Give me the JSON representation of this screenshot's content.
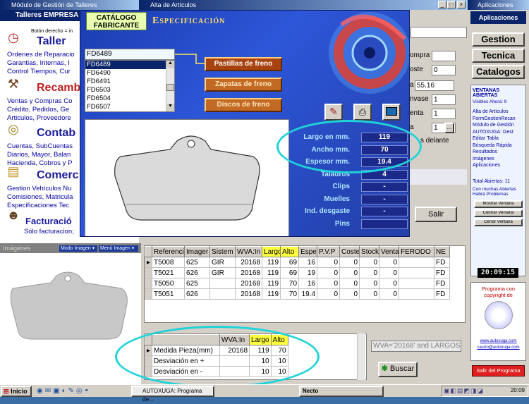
{
  "windows": {
    "left": {
      "title": "Módulo de Gestión de Talleres",
      "subtitle": "Talleres EMPRESA",
      "hint": "Botón derecho = in"
    },
    "alta": {
      "title": "Alta de Artículos"
    },
    "aplic": {
      "title": "Aplicaciones",
      "header": "Aplicaciones"
    }
  },
  "left_sections": [
    {
      "icon": "clock-icon",
      "title": "Taller",
      "lines": [
        "Ordenes de Reparacio",
        "Garantias, Internas, I",
        "Control Tiempos, Cur"
      ]
    },
    {
      "icon": "tools-icon",
      "title": "Recambio",
      "lines": [
        "Ventas y Compras Co",
        "Crédito, Pedidos, Ge",
        "Articulos, Proveedore"
      ]
    },
    {
      "icon": "coins-icon",
      "title": "Contab",
      "lines": [
        "Cuentas, SubCuentas",
        "Diarios, Mayor, Balan",
        "Hacienda, Cobros y P"
      ]
    },
    {
      "icon": "document-icon",
      "title": "Comerc",
      "lines": [
        "Gestion Vehículos Nu",
        "Comisiones, Matricula",
        "Especificaciones Tec"
      ]
    },
    {
      "icon": "person-icon",
      "title": "Facturació",
      "lines": [
        "Sólo facturacion;"
      ]
    }
  ],
  "catalog": {
    "logo_line1": "CATÁLOGO",
    "logo_line2": "FABRICANTE",
    "title": "Especificación",
    "search_value": "FD6489",
    "list_items": [
      "FD6489",
      "FD6490",
      "FD6491",
      "FD6503",
      "FD6504",
      "FD6507"
    ],
    "selected_index": 0,
    "categories": [
      "Pastillas de freno",
      "Zapatas de freno",
      "Discos de freno"
    ],
    "selected_category": 0,
    "specs": [
      {
        "label": "Largo en mm.",
        "value": "119"
      },
      {
        "label": "Ancho mm.",
        "value": "70"
      },
      {
        "label": "Espesor mm.",
        "value": "19.4"
      },
      {
        "label": "Taladros",
        "value": "4"
      },
      {
        "label": "Clips",
        "value": "-"
      },
      {
        "label": "Muelles",
        "value": "-"
      },
      {
        "label": "Ind. desgaste",
        "value": "-"
      },
      {
        "label": "Pins",
        "value": ""
      }
    ]
  },
  "alta_fields": {
    "labels": [
      "ompra",
      "oste",
      "a",
      "nvase",
      "enta",
      "a"
    ],
    "values": [
      "",
      "0",
      "55.16",
      "1",
      "1",
      "1"
    ],
    "right_text": "s delante",
    "salir": "Salir"
  },
  "images_panel": {
    "title": "Imágenes",
    "mode_label": "Modo Imagen",
    "menu_label": "Menú Imagen"
  },
  "grid": {
    "headers": [
      "Referenci",
      "Imager",
      "Sistem",
      "WVA:In",
      "Largo",
      "Alto",
      "Espe",
      "P.V.P",
      "Coste",
      "Stock",
      "Venta",
      "FERODO",
      "NE"
    ],
    "highlight_cols": [
      4,
      5
    ],
    "rows": [
      [
        "T5008",
        "625",
        "GIR",
        "20168",
        "119",
        "69",
        "16",
        "0",
        "0",
        "0",
        "0",
        "",
        "FD"
      ],
      [
        "T5021",
        "626",
        "GIR",
        "20168",
        "119",
        "69",
        "19",
        "0",
        "0",
        "0",
        "0",
        "",
        "FD"
      ],
      [
        "T5050",
        "625",
        "",
        "20168",
        "119",
        "70",
        "16",
        "0",
        "0",
        "0",
        "0",
        "",
        "FD"
      ],
      [
        "T5051",
        "626",
        "",
        "20168",
        "119",
        "70",
        "19.4",
        "0",
        "0",
        "0",
        "0",
        "",
        "FD"
      ]
    ]
  },
  "measure": {
    "headers": [
      "",
      "WVA:In",
      "Largo",
      "Alto"
    ],
    "rows": [
      [
        "Medida Pieza(mm)",
        "20168",
        "119",
        "70"
      ],
      [
        "Desviación en +",
        "",
        "10",
        "10"
      ],
      [
        "Desviación en -",
        "",
        "10",
        "10"
      ]
    ],
    "filter_text": "WVA='20168' and LARGOS",
    "search_button": "Buscar"
  },
  "aplic": {
    "buttons": [
      "Gestion",
      "Tecnica",
      "Catalogos"
    ],
    "open_header": "VENTANAS ABIERTAS",
    "visible": "Visibles Ahora: 9",
    "items": [
      "Alta de Artículos",
      "FormGestionRecan",
      "Módulo de Gestión",
      "AUTOXUGA: Gest",
      "Editar Tabla",
      "Búsqueda Rápida",
      "Resultados",
      "Imágenes",
      "Aplicaciones"
    ],
    "total": "Total Abiertas: 11",
    "warning_line1": "Con muchas Abiertas",
    "warning_line2": "Habrá Problemas",
    "actions": [
      "Mostrar Ventana",
      "Centrar Ventana",
      "Cerrar Ventana"
    ],
    "clock": "20:09:15",
    "copyright_line1": "Programa con",
    "copyright_line2": "copyright de",
    "link1": "www.autoxuga.com",
    "link2": "castro@autoxuga.com",
    "exit": "Salir del Programa"
  },
  "taskbar": {
    "start": "Inicio",
    "task1": "AUTOXUGA: Programa de...",
    "task2": "Necto",
    "time": "20:09"
  }
}
